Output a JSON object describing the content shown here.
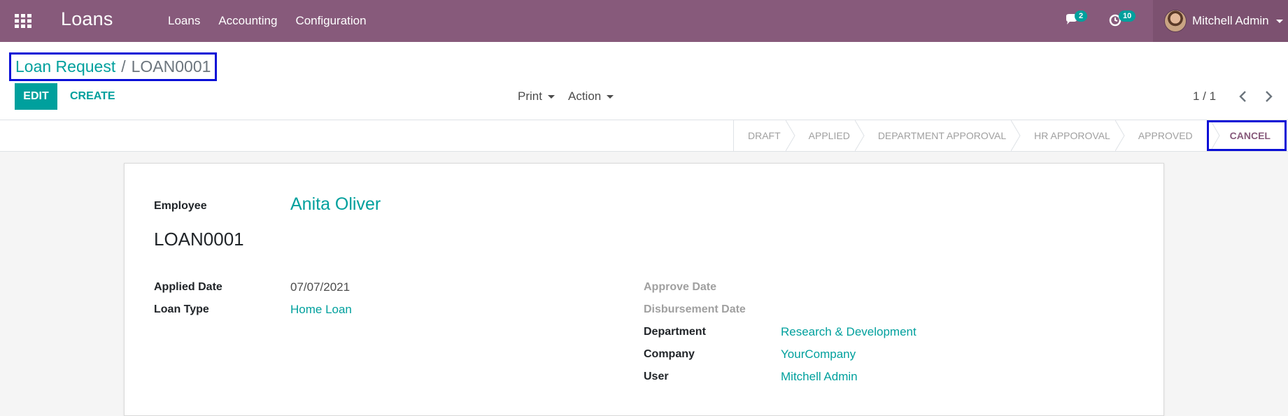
{
  "navbar": {
    "app_title": "Loans",
    "menu": [
      "Loans",
      "Accounting",
      "Configuration"
    ],
    "messages_count": "2",
    "activities_count": "10",
    "user_name": "Mitchell Admin",
    "bg_color": "#875a7b"
  },
  "breadcrumb": {
    "parent": "Loan Request",
    "separator": "/",
    "current": "LOAN0001"
  },
  "buttons": {
    "edit": "EDIT",
    "create": "CREATE",
    "print": "Print",
    "action": "Action"
  },
  "pager": {
    "value": "1 / 1"
  },
  "statusbar": {
    "stages": [
      "DRAFT",
      "APPLIED",
      "DEPARTMENT APPOROVAL",
      "HR APPOROVAL",
      "APPROVED",
      "CANCEL"
    ],
    "active_stage": "CANCEL"
  },
  "form": {
    "employee_label": "Employee",
    "employee_name": "Anita Oliver",
    "reference": "LOAN0001",
    "applied_date_label": "Applied Date",
    "applied_date": "07/07/2021",
    "loan_type_label": "Loan Type",
    "loan_type": "Home Loan",
    "approve_date_label": "Approve Date",
    "disbursement_date_label": "Disbursement Date",
    "department_label": "Department",
    "department": "Research & Development",
    "company_label": "Company",
    "company": "YourCompany",
    "user_label": "User",
    "user": "Mitchell Admin"
  },
  "colors": {
    "accent": "#00a09d",
    "brand": "#875a7b",
    "highlight_border": "#0a0fd6"
  }
}
